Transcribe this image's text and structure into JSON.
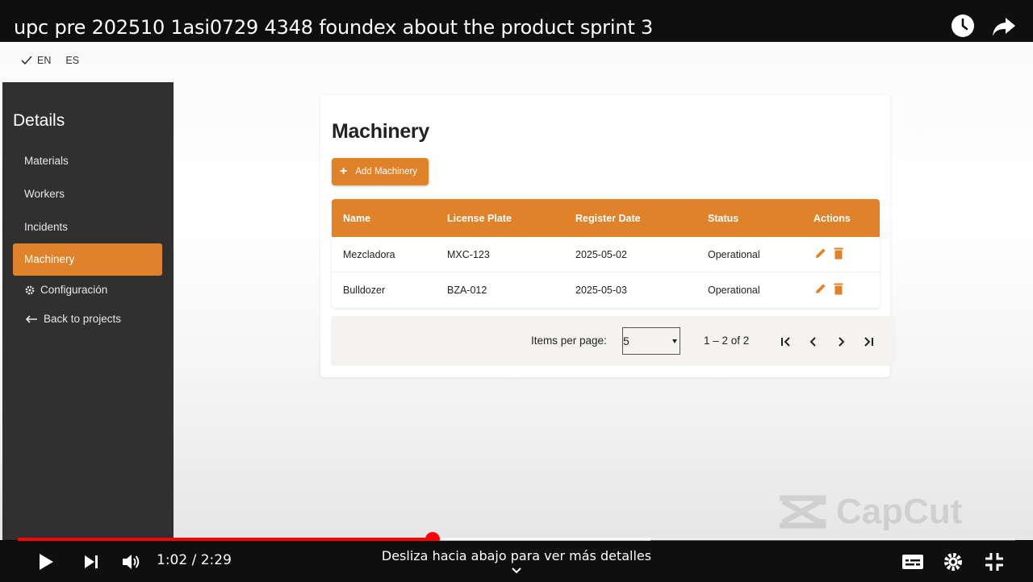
{
  "video": {
    "title": "upc pre 202510 1asi0729 4348 foundex about the product sprint 3",
    "icons": {
      "watch_later": "clock-icon",
      "share": "share-icon"
    }
  },
  "app": {
    "languages": [
      {
        "label": "EN",
        "selected": true
      },
      {
        "label": "ES",
        "selected": false
      }
    ],
    "sidebar": {
      "title": "Details",
      "items": [
        {
          "label": "Materials",
          "active": false
        },
        {
          "label": "Workers",
          "active": false
        },
        {
          "label": "Incidents",
          "active": false
        },
        {
          "label": "Machinery",
          "active": true
        }
      ],
      "settings_label": "Configuración",
      "back_label": "Back to projects"
    },
    "page_title": "Machinery",
    "add_button_label": "Add Machinery",
    "table": {
      "headers": [
        "Name",
        "License Plate",
        "Register Date",
        "Status",
        "Actions"
      ],
      "rows": [
        {
          "name": "Mezcladora",
          "plate": "MXC-123",
          "date": "2025-05-02",
          "status": "Operational"
        },
        {
          "name": "Bulldozer",
          "plate": "BZA-012",
          "date": "2025-05-03",
          "status": "Operational"
        }
      ]
    },
    "paginator": {
      "items_per_page_label": "Items per page:",
      "items_per_page_value": "5",
      "range_label": "1 – 2 of 2"
    },
    "watermark": "CapCut",
    "colors": {
      "accent": "#e0822a",
      "sidebar_bg": "#303030",
      "progress": "#ff0000"
    }
  },
  "player": {
    "current_time": "1:02",
    "duration": "2:29",
    "time_display": "1:02 / 2:29",
    "progress_fraction": 0.416,
    "buffered_fraction": 0.634,
    "swipe_hint": "Desliza hacia abajo para ver más detalles"
  }
}
